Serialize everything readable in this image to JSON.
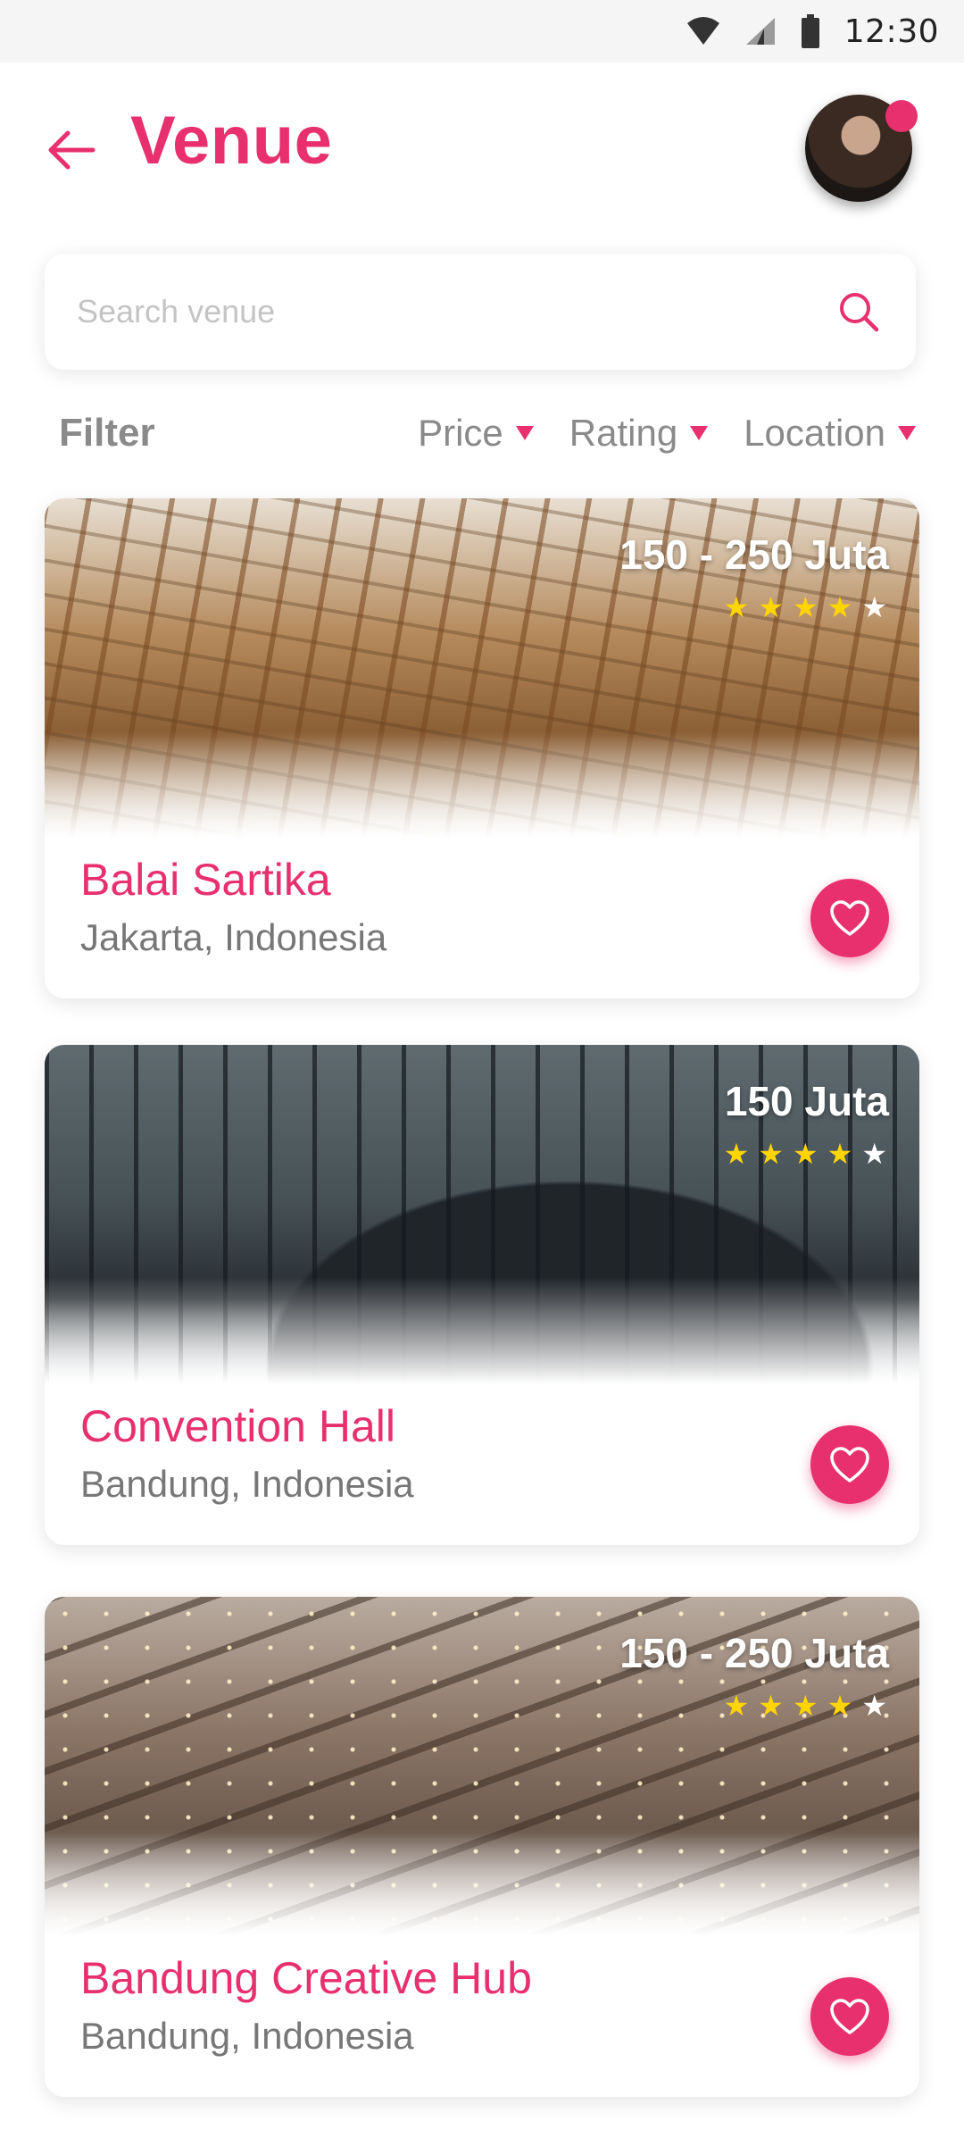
{
  "status_bar": {
    "time": "12:30"
  },
  "header": {
    "title": "Venue"
  },
  "search": {
    "placeholder": "Search venue"
  },
  "filter": {
    "label": "Filter",
    "options": [
      {
        "label": "Price"
      },
      {
        "label": "Rating"
      },
      {
        "label": "Location"
      }
    ]
  },
  "venues": [
    {
      "name": "Balai Sartika",
      "location": "Jakarta, Indonesia",
      "price": "150 - 250 Juta",
      "rating": 4,
      "max_rating": 5
    },
    {
      "name": "Convention Hall",
      "location": "Bandung, Indonesia",
      "price": "150 Juta",
      "rating": 4,
      "max_rating": 5
    },
    {
      "name": "Bandung Creative Hub",
      "location": "Bandung, Indonesia",
      "price": "150 - 250 Juta",
      "rating": 4,
      "max_rating": 5
    }
  ],
  "colors": {
    "accent": "#e8306e",
    "star": "#ffd500"
  },
  "icons": {
    "back": "arrow-left-icon",
    "search": "search-icon",
    "favorite": "heart-icon",
    "dropdown": "caret-down-icon",
    "star": "star-icon"
  }
}
